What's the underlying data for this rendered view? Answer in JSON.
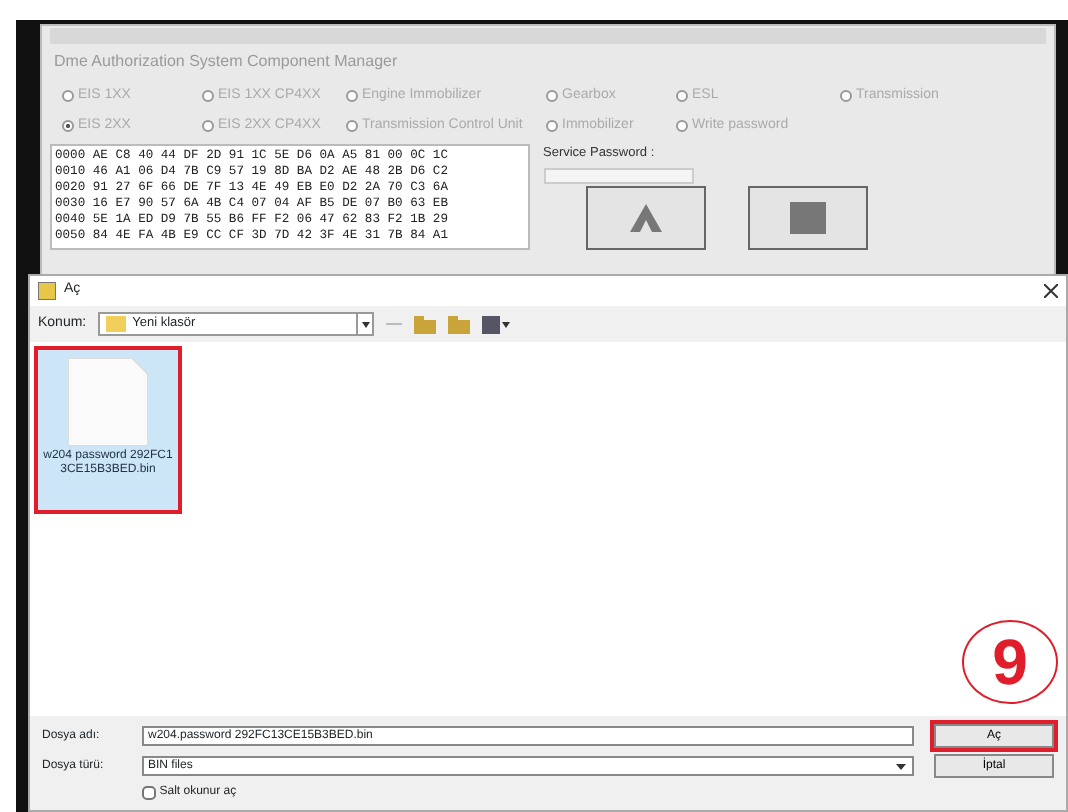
{
  "back_window": {
    "title": "Dme Authorization System Component Manager",
    "radios": [
      {
        "label": "EIS 1XX",
        "selected": false
      },
      {
        "label": "EIS 1XX CP4XX",
        "selected": false
      },
      {
        "label": "Engine Immobilizer",
        "selected": false
      },
      {
        "label": "Gearbox",
        "selected": false
      },
      {
        "label": "ESL",
        "selected": false
      },
      {
        "label": "Transmission",
        "selected": false
      },
      {
        "label": "EIS 2XX",
        "selected": true
      },
      {
        "label": "EIS 2XX CP4XX",
        "selected": false
      },
      {
        "label": "Transmission Control Unit",
        "selected": false
      },
      {
        "label": "Immobilizer",
        "selected": false
      },
      {
        "label": "Write password",
        "selected": false
      }
    ],
    "hex_lines": [
      "0000 AE C8 40 44 DF 2D 91 1C 5E D6 0A A5 81 00 0C 1C",
      "0010 46 A1 06 D4 7B C9 57 19 8D BA D2 AE 48 2B D6 C2",
      "0020 91 27 6F 66 DE 7F 13 4E 49 EB E0 D2 2A 70 C3 6A",
      "0030 16 E7 90 57 6A 4B C4 07 04 AF B5 DE 07 B0 63 EB",
      "0040 5E 1A ED D9 7B 55 B6 FF F2 06 47 62 83 F2 1B 29",
      "0050 84 4E FA 4B E9 CC CF 3D 7D 42 3F 4E 31 7B 84 A1"
    ],
    "service_password_label": "Service Password :"
  },
  "dialog": {
    "title": "Aç",
    "location_label": "Konum:",
    "location": "Yeni klasör",
    "files": [
      {
        "name": "w204 password 292FC13CE15B3BED.bin",
        "selected": true
      }
    ],
    "filename_label": "Dosya adı:",
    "filename": "w204.password 292FC13CE15B3BED.bin",
    "filetype_label": "Dosya türü:",
    "filetype": "BIN files",
    "readonly": {
      "label": "Salt okunur aç",
      "checked": false
    },
    "buttons": [
      {
        "label": "Aç",
        "highlighted": true
      },
      {
        "label": "İptal",
        "highlighted": false
      }
    ]
  },
  "annotation": {
    "step": "9"
  }
}
